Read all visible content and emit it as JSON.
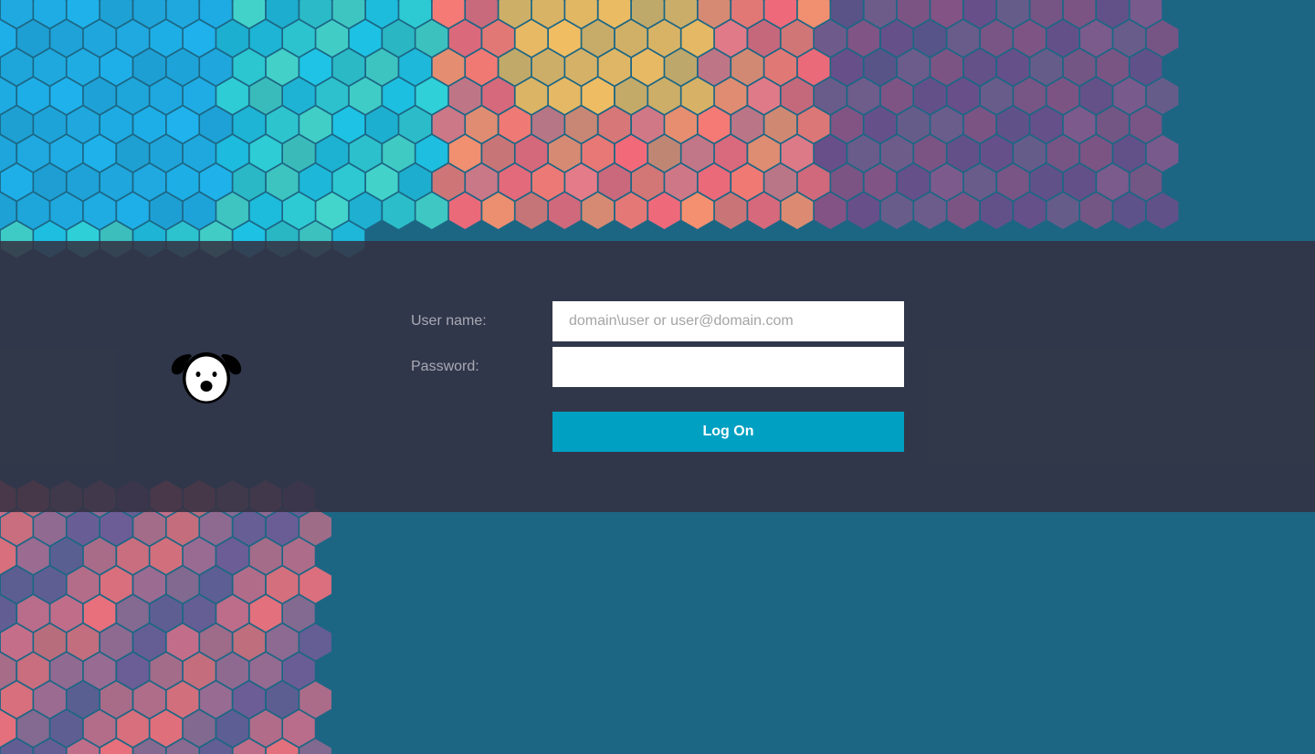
{
  "login": {
    "username_label": "User name:",
    "username_placeholder": "domain\\user or user@domain.com",
    "username_value": "",
    "password_label": "Password:",
    "password_value": "",
    "logon_label": "Log On"
  },
  "logo": {
    "icon": "dog-face-icon"
  },
  "colors": {
    "background": "#1c6684",
    "band": "#343040",
    "button": "#00a0c2",
    "label": "#a9a9b4",
    "field": "#ffffff"
  }
}
